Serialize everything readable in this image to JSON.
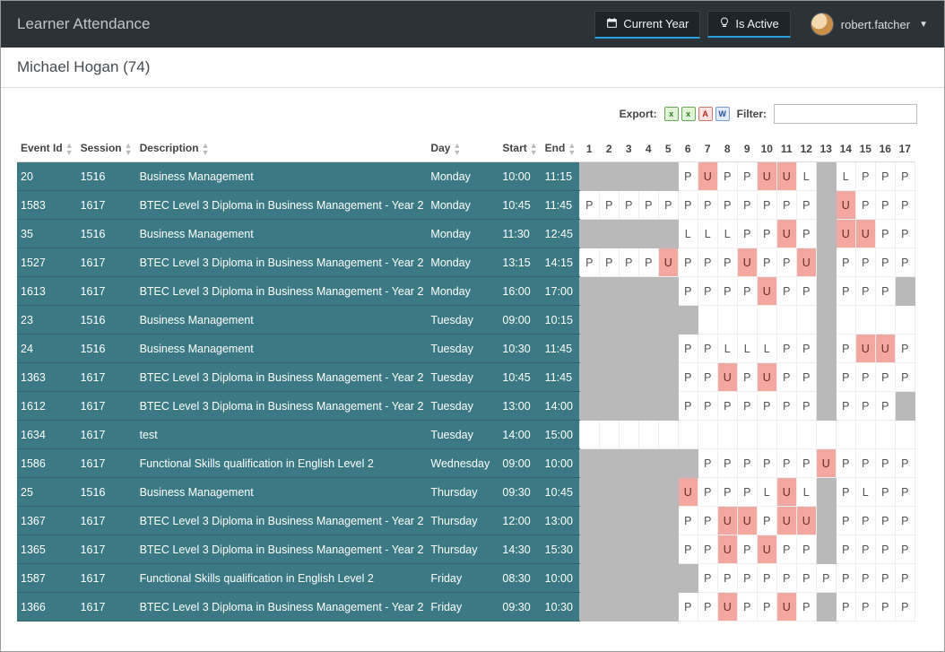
{
  "header": {
    "title": "Learner Attendance",
    "buttons": {
      "current_year": "Current Year",
      "is_active": "Is Active"
    },
    "user": {
      "name": "robert.fatcher"
    }
  },
  "subheader": {
    "learner": "Michael Hogan (74)"
  },
  "toolbar": {
    "export_label": "Export:",
    "filter_label": "Filter:",
    "filter_value": ""
  },
  "columns": {
    "event_id": "Event Id",
    "session": "Session",
    "description": "Description",
    "day": "Day",
    "start": "Start",
    "end": "End",
    "weeks": [
      "1",
      "2",
      "3",
      "4",
      "5",
      "6",
      "7",
      "8",
      "9",
      "10",
      "11",
      "12",
      "13",
      "14",
      "15",
      "16",
      "17"
    ]
  },
  "rows": [
    {
      "event": "20",
      "session": "1516",
      "desc": "Business Management",
      "day": "Monday",
      "start": "10:00",
      "end": "11:15",
      "att": [
        "",
        "",
        "",
        "",
        "",
        "P",
        "U",
        "P",
        "P",
        "U",
        "U",
        "L",
        "",
        "L",
        "P",
        "P",
        "P"
      ]
    },
    {
      "event": "1583",
      "session": "1617",
      "desc": "BTEC Level 3 Diploma in Business Management - Year 2",
      "day": "Monday",
      "start": "10:45",
      "end": "11:45",
      "att": [
        "P",
        "P",
        "P",
        "P",
        "P",
        "P",
        "P",
        "P",
        "P",
        "P",
        "P",
        "P",
        "",
        "U",
        "P",
        "P",
        "P"
      ]
    },
    {
      "event": "35",
      "session": "1516",
      "desc": "Business Management",
      "day": "Monday",
      "start": "11:30",
      "end": "12:45",
      "att": [
        "",
        "",
        "",
        "",
        "",
        "L",
        "L",
        "L",
        "P",
        "P",
        "U",
        "P",
        "",
        "U",
        "U",
        "P",
        "P"
      ]
    },
    {
      "event": "1527",
      "session": "1617",
      "desc": "BTEC Level 3 Diploma in Business Management - Year 2",
      "day": "Monday",
      "start": "13:15",
      "end": "14:15",
      "att": [
        "P",
        "P",
        "P",
        "P",
        "U",
        "P",
        "P",
        "P",
        "U",
        "P",
        "P",
        "U",
        "",
        "P",
        "P",
        "P",
        "P"
      ]
    },
    {
      "event": "1613",
      "session": "1617",
      "desc": "BTEC Level 3 Diploma in Business Management - Year 2",
      "day": "Monday",
      "start": "16:00",
      "end": "17:00",
      "att": [
        "",
        "",
        "",
        "",
        "",
        "P",
        "P",
        "P",
        "P",
        "U",
        "P",
        "P",
        "",
        "P",
        "P",
        "P",
        ""
      ]
    },
    {
      "event": "23",
      "session": "1516",
      "desc": "Business Management",
      "day": "Tuesday",
      "start": "09:00",
      "end": "10:15",
      "att": [
        "",
        "",
        "",
        "",
        "",
        "",
        "-",
        "-",
        "-",
        "-",
        "-",
        "-",
        "",
        "-",
        "-",
        "-",
        "-"
      ]
    },
    {
      "event": "24",
      "session": "1516",
      "desc": "Business Management",
      "day": "Tuesday",
      "start": "10:30",
      "end": "11:45",
      "att": [
        "",
        "",
        "",
        "",
        "",
        "P",
        "P",
        "L",
        "L",
        "L",
        "P",
        "P",
        "",
        "P",
        "U",
        "U",
        "P"
      ]
    },
    {
      "event": "1363",
      "session": "1617",
      "desc": "BTEC Level 3 Diploma in Business Management - Year 2",
      "day": "Tuesday",
      "start": "10:45",
      "end": "11:45",
      "att": [
        "",
        "",
        "",
        "",
        "",
        "P",
        "P",
        "U",
        "P",
        "U",
        "P",
        "P",
        "",
        "P",
        "P",
        "P",
        "P"
      ]
    },
    {
      "event": "1612",
      "session": "1617",
      "desc": "BTEC Level 3 Diploma in Business Management - Year 2",
      "day": "Tuesday",
      "start": "13:00",
      "end": "14:00",
      "att": [
        "",
        "",
        "",
        "",
        "",
        "P",
        "P",
        "P",
        "P",
        "P",
        "P",
        "P",
        "",
        "P",
        "P",
        "P",
        ""
      ]
    },
    {
      "event": "1634",
      "session": "1617",
      "desc": "test",
      "day": "Tuesday",
      "start": "14:00",
      "end": "15:00",
      "att": [
        "-",
        "-",
        "-",
        "-",
        "-",
        "-",
        "-",
        "-",
        "-",
        "-",
        "-",
        "-",
        "-",
        "-",
        "-",
        "-",
        "-"
      ]
    },
    {
      "event": "1586",
      "session": "1617",
      "desc": "Functional Skills qualification in English Level 2",
      "day": "Wednesday",
      "start": "09:00",
      "end": "10:00",
      "att": [
        "",
        "",
        "",
        "",
        "",
        "",
        "P",
        "P",
        "P",
        "P",
        "P",
        "P",
        "U",
        "P",
        "P",
        "P",
        "P"
      ]
    },
    {
      "event": "25",
      "session": "1516",
      "desc": "Business Management",
      "day": "Thursday",
      "start": "09:30",
      "end": "10:45",
      "att": [
        "",
        "",
        "",
        "",
        "",
        "U",
        "P",
        "P",
        "P",
        "L",
        "U",
        "L",
        "",
        "P",
        "L",
        "P",
        "P"
      ]
    },
    {
      "event": "1367",
      "session": "1617",
      "desc": "BTEC Level 3 Diploma in Business Management - Year 2",
      "day": "Thursday",
      "start": "12:00",
      "end": "13:00",
      "att": [
        "",
        "",
        "",
        "",
        "",
        "P",
        "P",
        "U",
        "U",
        "P",
        "U",
        "U",
        "",
        "P",
        "P",
        "P",
        "P"
      ]
    },
    {
      "event": "1365",
      "session": "1617",
      "desc": "BTEC Level 3 Diploma in Business Management - Year 2",
      "day": "Thursday",
      "start": "14:30",
      "end": "15:30",
      "att": [
        "",
        "",
        "",
        "",
        "",
        "P",
        "P",
        "U",
        "P",
        "U",
        "P",
        "P",
        "",
        "P",
        "P",
        "P",
        "P"
      ]
    },
    {
      "event": "1587",
      "session": "1617",
      "desc": "Functional Skills qualification in English Level 2",
      "day": "Friday",
      "start": "08:30",
      "end": "10:00",
      "att": [
        "",
        "",
        "",
        "",
        "",
        "",
        "P",
        "P",
        "P",
        "P",
        "P",
        "P",
        "P",
        "P",
        "P",
        "P",
        "P"
      ]
    },
    {
      "event": "1366",
      "session": "1617",
      "desc": "BTEC Level 3 Diploma in Business Management - Year 2",
      "day": "Friday",
      "start": "09:30",
      "end": "10:30",
      "att": [
        "",
        "",
        "",
        "",
        "",
        "P",
        "P",
        "U",
        "P",
        "P",
        "U",
        "P",
        "",
        "P",
        "P",
        "P",
        "P"
      ]
    }
  ]
}
